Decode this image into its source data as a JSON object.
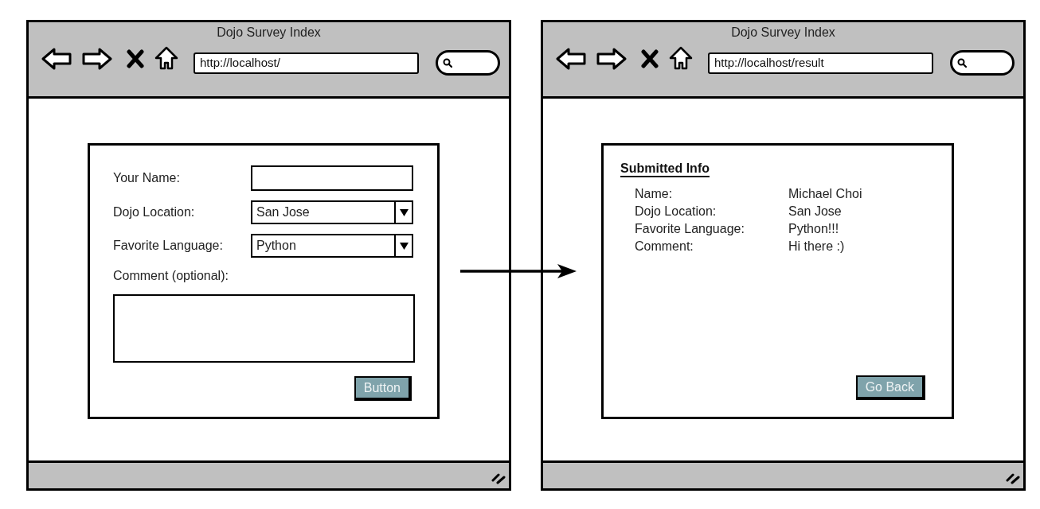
{
  "windows": [
    {
      "title": "Dojo Survey Index",
      "address": "http://localhost/",
      "page": {
        "kind": "form",
        "fields": [
          {
            "kind": "text",
            "label": "Your Name:"
          },
          {
            "kind": "select",
            "label": "Dojo Location:",
            "value": "San Jose"
          },
          {
            "kind": "select",
            "label": "Favorite Language:",
            "value": "Python"
          },
          {
            "kind": "textarea",
            "label": "Comment (optional):"
          }
        ],
        "button": "Button"
      }
    },
    {
      "title": "Dojo Survey Index",
      "address": "http://localhost/result",
      "page": {
        "kind": "result",
        "heading": "Submitted Info",
        "rows": [
          {
            "label": "Name:",
            "value": "Michael Choi"
          },
          {
            "label": "Dojo Location:",
            "value": "San Jose"
          },
          {
            "label": "Favorite Language:",
            "value": "Python!!!"
          },
          {
            "label": "Comment:",
            "value": "Hi there :)"
          }
        ],
        "button": "Go Back"
      }
    }
  ]
}
